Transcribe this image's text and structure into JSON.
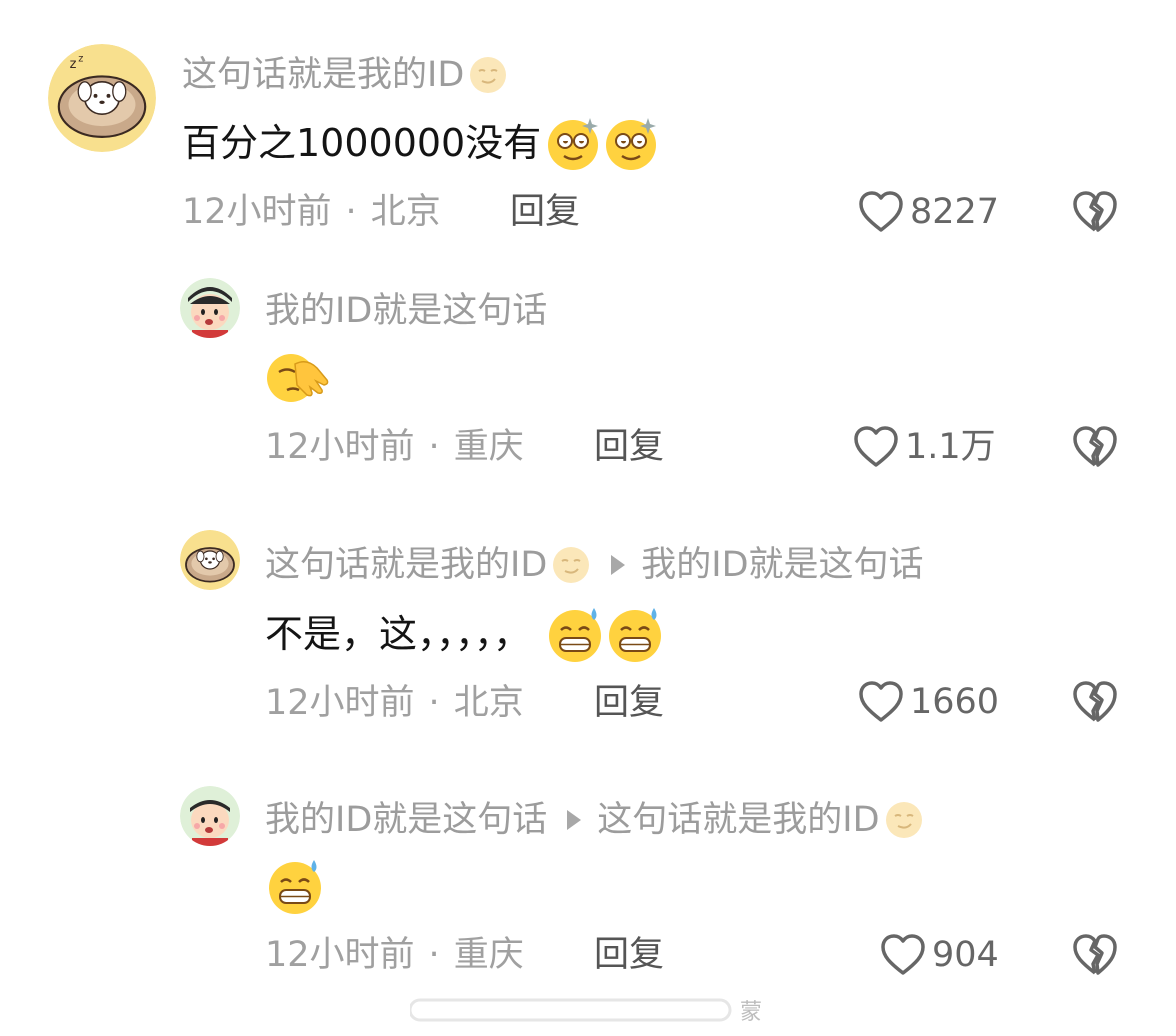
{
  "comments": [
    {
      "username": "这句话就是我的ID",
      "text": "百分之1000000没有",
      "time": "12小时前",
      "location": "北京",
      "reply_label": "回复",
      "likes": "8227",
      "avatar_icon": "puppy-avatar",
      "emoji_icons": [
        "dazzled-face-emoji",
        "dazzled-face-emoji"
      ]
    },
    {
      "username": "我的ID就是这句话",
      "text": "",
      "time": "12小时前",
      "location": "重庆",
      "reply_label": "回复",
      "likes": "1.1万",
      "avatar_icon": "cartoon-boy-avatar",
      "emoji_icons": [
        "facepalm-emoji"
      ]
    },
    {
      "username": "这句话就是我的ID",
      "reply_to": "我的ID就是这句话",
      "text": "不是，这，，，，，",
      "time": "12小时前",
      "location": "北京",
      "reply_label": "回复",
      "likes": "1660",
      "avatar_icon": "puppy-avatar",
      "emoji_icons": [
        "grinning-sweat-emoji",
        "grinning-sweat-emoji"
      ]
    },
    {
      "username": "我的ID就是这句话",
      "reply_to": "这句话就是我的ID",
      "text": "",
      "time": "12小时前",
      "location": "重庆",
      "reply_label": "回复",
      "likes": "904",
      "avatar_icon": "cartoon-boy-avatar",
      "emoji_icons": [
        "grinning-sweat-emoji"
      ]
    }
  ],
  "watermark": "蒙",
  "colors": {
    "username": "#9c9c9c",
    "text": "#141414",
    "meta": "#a0a0a0",
    "emoji_face": "#ffd23f"
  }
}
